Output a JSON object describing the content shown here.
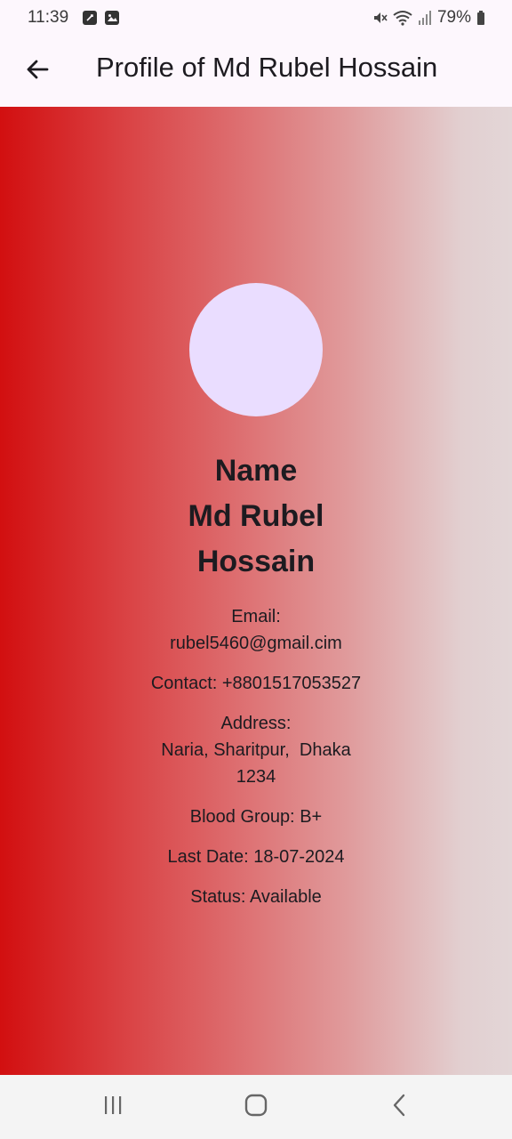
{
  "status_bar": {
    "time": "11:39",
    "battery": "79%"
  },
  "app_bar": {
    "title": "Profile of Md Rubel Hossain"
  },
  "profile": {
    "name_heading": "Name",
    "name": "Md Rubel Hossain",
    "email_label": "Email:",
    "email": "rubel5460@gmail.cim",
    "contact_label": "Contact:",
    "contact": "+8801517053527",
    "address_label": "Address:",
    "address": "Naria, Sharitpur,  Dhaka 1234",
    "blood_group_label": "Blood Group:",
    "blood_group": "B+",
    "last_date_label": "Last Date:",
    "last_date": "18-07-2024",
    "status_label": "Status:",
    "status": "Available"
  },
  "colors": {
    "gradient_start": "#d20f10",
    "gradient_end": "#e3d6d7",
    "avatar": "#eaddff",
    "app_bar_bg": "#fdf7fd"
  },
  "icons": {
    "back": "arrow-left-icon",
    "recents": "recents-icon",
    "home": "home-icon",
    "nav_back": "chevron-left-icon"
  }
}
